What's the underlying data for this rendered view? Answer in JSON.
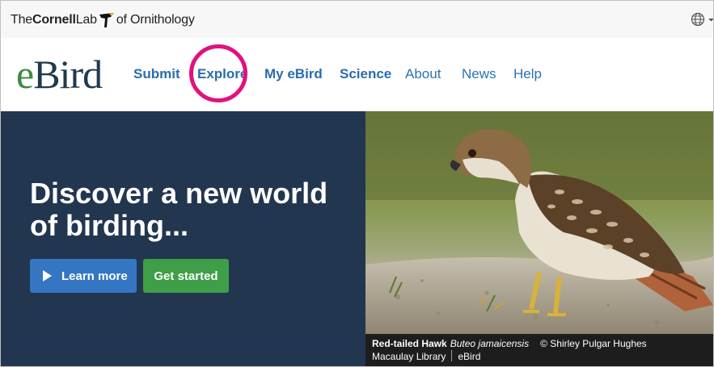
{
  "topbar": {
    "logo_the": "The",
    "logo_cornell": "Cornell",
    "logo_lab": "Lab",
    "logo_of": "of Ornithology",
    "globe_icon": "globe-icon",
    "caret_icon": "chevron-down-icon"
  },
  "nav": {
    "logo_e": "e",
    "logo_bird": "Bird",
    "items": [
      {
        "label": "Submit"
      },
      {
        "label": "Explore"
      },
      {
        "label": "My eBird"
      },
      {
        "label": "Science"
      },
      {
        "label": "About"
      },
      {
        "label": "News"
      },
      {
        "label": "Help"
      }
    ],
    "highlight_color": "#e0127f"
  },
  "hero": {
    "heading": "Discover a new world of birding...",
    "learn_more": "Learn more",
    "get_started": "Get started",
    "colors": {
      "panel": "#23364f",
      "learn_more": "#3576c2",
      "get_started": "#3f9e48"
    }
  },
  "photo": {
    "common_name": "Red-tailed Hawk",
    "scientific_name": "Buteo jamaicensis",
    "credit": "© Shirley Pulgar Hughes",
    "source_1": "Macaulay Library",
    "source_2": "eBird"
  }
}
